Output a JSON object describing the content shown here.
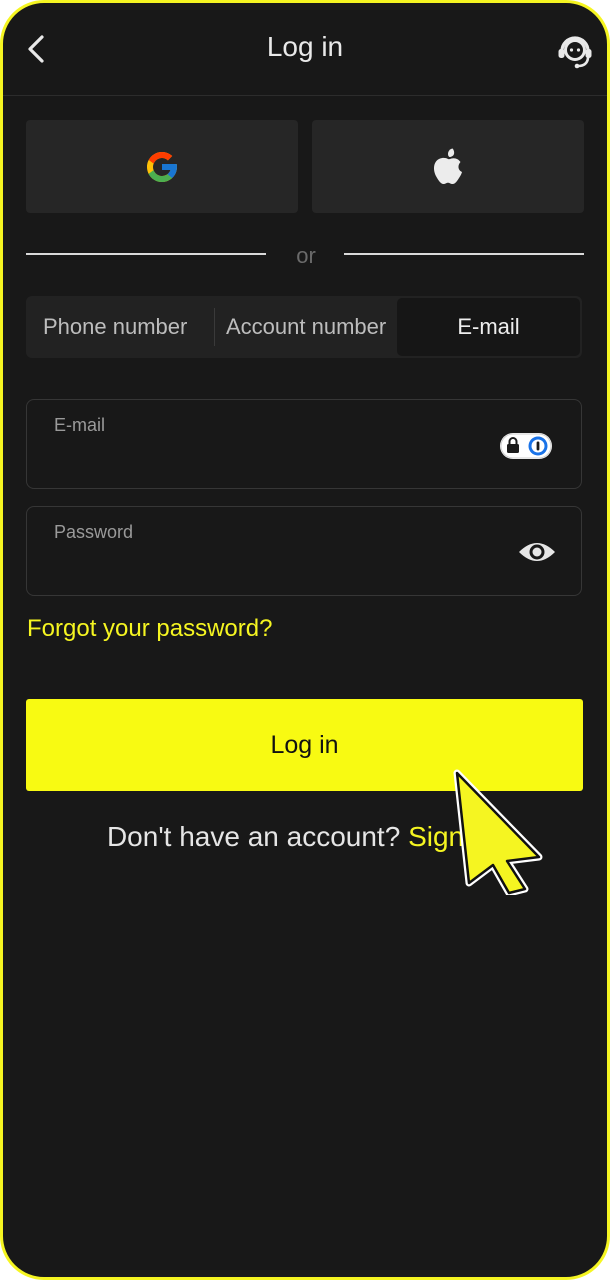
{
  "header": {
    "title": "Log in",
    "back_icon": "chevron-left-icon",
    "support_icon": "headset-support-icon"
  },
  "social": {
    "google_icon": "google-logo-icon",
    "apple_icon": "apple-logo-icon"
  },
  "divider": {
    "text": "or"
  },
  "tabs": [
    {
      "label": "Phone number",
      "selected": false
    },
    {
      "label": "Account number",
      "selected": false
    },
    {
      "label": "E-mail",
      "selected": true
    }
  ],
  "form": {
    "email": {
      "label": "E-mail",
      "value": ""
    },
    "password": {
      "label": "Password",
      "value": ""
    },
    "forgot_label": "Forgot your password?",
    "login_label": "Log in"
  },
  "signup": {
    "prompt": "Don't have an account?",
    "link": "Sign up"
  },
  "colors": {
    "accent": "#f8fa12",
    "background": "#181818",
    "surface": "#262626",
    "text": "#e9e9e9"
  }
}
